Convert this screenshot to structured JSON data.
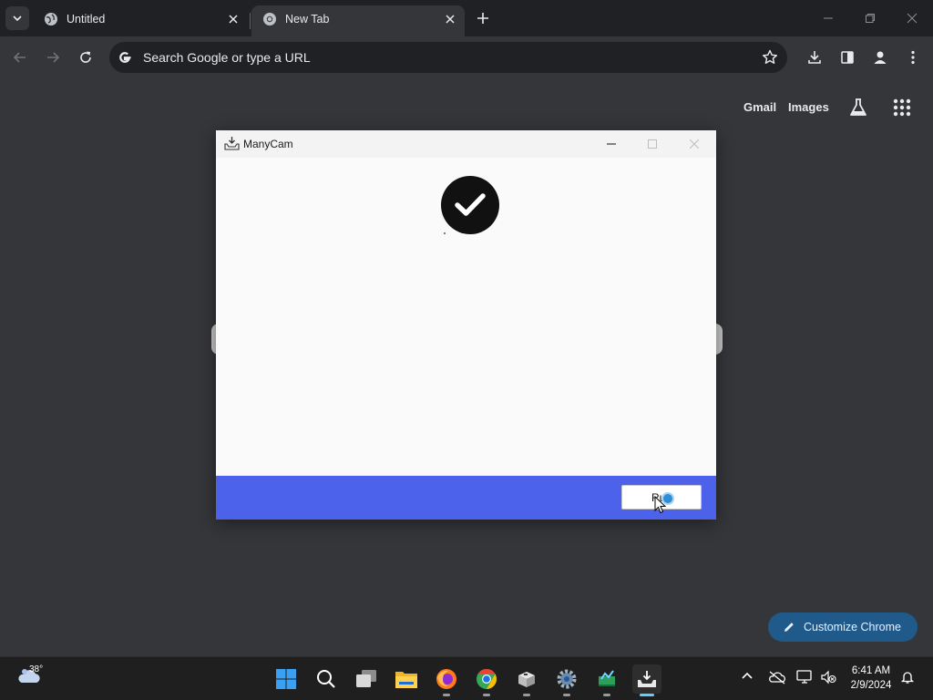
{
  "browser": {
    "tabs": [
      {
        "title": "Untitled",
        "active": false
      },
      {
        "title": "New Tab",
        "active": true
      }
    ],
    "omnibox": {
      "placeholder": "Search Google or type a URL"
    },
    "ntp": {
      "links": [
        "Gmail",
        "Images"
      ],
      "customize_label": "Customize Chrome"
    }
  },
  "app_window": {
    "title": "ManyCam",
    "run_button_label": "Run",
    "footer_color": "#4c62eb"
  },
  "taskbar": {
    "weather_temp": "38°",
    "pinned": [
      "start",
      "search",
      "task-view",
      "file-explorer",
      "firefox",
      "chrome",
      "app-box",
      "settings",
      "app-green",
      "installer"
    ],
    "active_app": "installer"
  },
  "clock": {
    "time": "6:41 AM",
    "date": "2/9/2024"
  },
  "colors": {
    "accent_blue": "#4c62eb",
    "chrome_dark": "#202124",
    "customize_btn": "#1f5a8b"
  }
}
